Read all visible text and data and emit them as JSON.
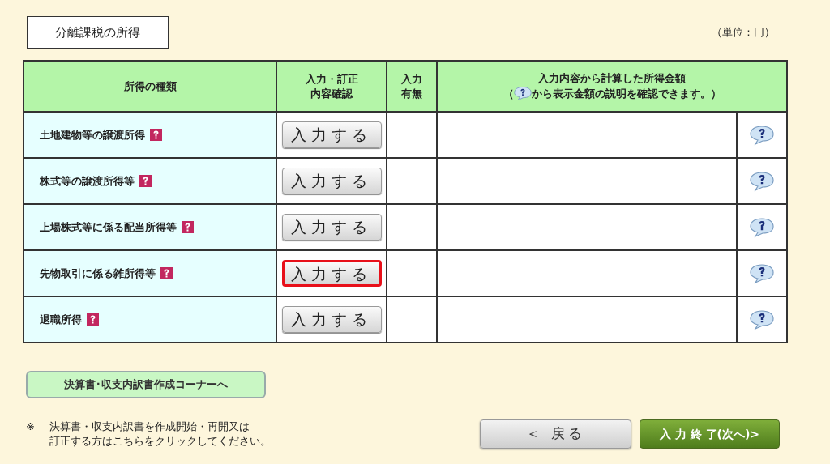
{
  "title": "分離課税の所得",
  "unit": "（単位：円）",
  "table": {
    "columns": [
      {
        "lines": [
          "所得の種類"
        ]
      },
      {
        "lines": [
          "入力・訂正",
          "内容確認"
        ]
      },
      {
        "lines": [
          "入力",
          "有無"
        ]
      },
      {
        "label": "入力内容から計算した所得金額",
        "note_before": "（",
        "note_after": "から表示金額の説明を確認できます。）"
      }
    ],
    "rows": [
      {
        "name": "土地建物等の譲渡所得",
        "button": "入力する",
        "highlighted": false
      },
      {
        "name": "株式等の譲渡所得等",
        "button": "入力する",
        "highlighted": false
      },
      {
        "name": "上場株式等に係る配当所得等",
        "button": "入力する",
        "highlighted": false
      },
      {
        "name": "先物取引に係る雑所得等",
        "button": "入力する",
        "highlighted": true
      },
      {
        "name": "退職所得",
        "button": "入力する",
        "highlighted": false
      }
    ]
  },
  "corner_button": "決算書･収支内訳書作成コーナーへ",
  "note_mark": "※",
  "note": [
    "決算書・収支内訳書を作成開始・再開又は",
    "訂正する方はこちらをクリックしてください。"
  ],
  "back_button": "＜ 戻る",
  "next_button": "入 力 終 了(次へ)>"
}
